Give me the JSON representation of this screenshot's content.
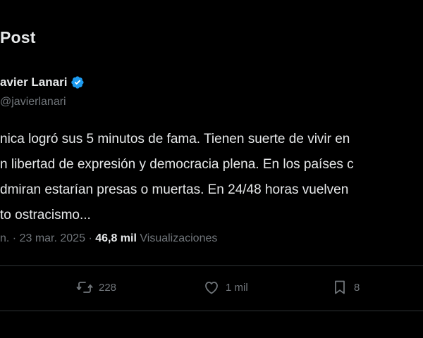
{
  "header": {
    "title": "Post"
  },
  "tweet": {
    "author_name": "avier Lanari",
    "handle": "@javierlanari",
    "text_lines": [
      "nica logró sus 5 minutos de fama. Tienen suerte de vivir en",
      "n libertad de expresión y democracia plena. En los países c",
      "dmiran estarían presas o muertas. En 24/48 horas vuelven",
      "to ostracismo..."
    ],
    "time": "n.",
    "date": "23 mar. 2025",
    "views_count": "46,8 mil",
    "views_label": "Visualizaciones"
  },
  "actions": {
    "reposts": "228",
    "likes": "1 mil",
    "bookmarks": "8"
  },
  "colors": {
    "background": "#000000",
    "text": "#e7e9ea",
    "muted": "#71767b",
    "verified": "#1d9bf0",
    "divider": "#2f3336"
  },
  "icons": [
    "verified-badge-icon",
    "repost-icon",
    "like-icon",
    "bookmark-icon"
  ]
}
